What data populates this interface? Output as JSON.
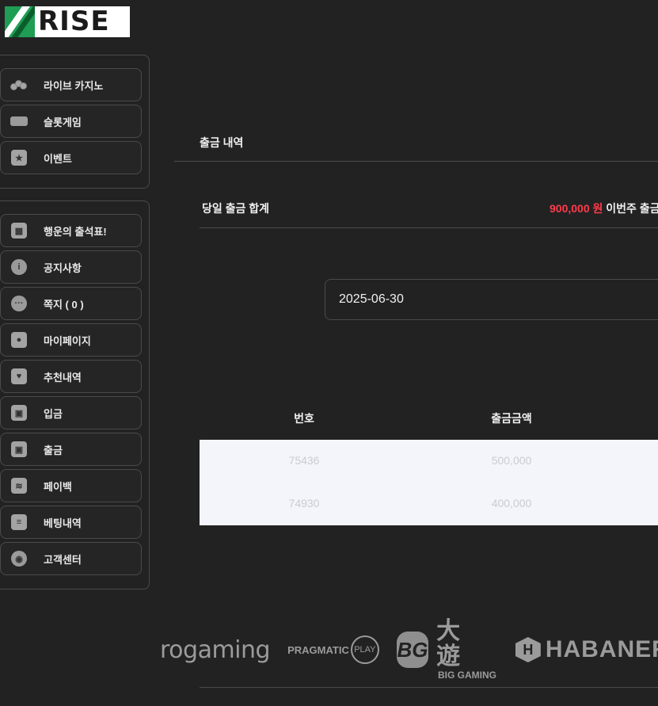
{
  "brand": {
    "name": "RISE"
  },
  "sidebar": {
    "group1": [
      {
        "label": "라이브 카지노",
        "icon": "casino-chips-icon"
      },
      {
        "label": "슬롯게임",
        "icon": "slot-machine-icon"
      },
      {
        "label": "이벤트",
        "icon": "event-star-icon"
      }
    ],
    "group2": [
      {
        "label": "행운의 출석표!",
        "icon": "calendar-icon"
      },
      {
        "label": "공지사항",
        "icon": "info-icon",
        "glyph": "i"
      },
      {
        "label": "쪽지 ( 0 )",
        "icon": "message-icon",
        "glyph": "···"
      },
      {
        "label": "마이페이지",
        "icon": "user-icon"
      },
      {
        "label": "추천내역",
        "icon": "heart-icon",
        "glyph": "♥"
      },
      {
        "label": "입금",
        "icon": "wallet-deposit-icon"
      },
      {
        "label": "출금",
        "icon": "wallet-withdraw-icon"
      },
      {
        "label": "페이백",
        "icon": "coins-icon"
      },
      {
        "label": "베팅내역",
        "icon": "bet-history-icon"
      },
      {
        "label": "고객센터",
        "icon": "support-icon"
      }
    ]
  },
  "main": {
    "title": "출금 내역",
    "summary": {
      "label": "당일 출금 합계",
      "amount": "900,000 원",
      "week_label": "이번주 출금 합계"
    },
    "date_value": "2025-06-30",
    "table": {
      "headers": [
        "번호",
        "출금금액"
      ],
      "rows": [
        [
          "75436",
          "500,000"
        ],
        [
          "74930",
          "400,000"
        ]
      ]
    },
    "providers": [
      {
        "name": "evolution-gaming",
        "text": "rogaming"
      },
      {
        "name": "pragmatic-play",
        "text": "PRAGMATIC",
        "badge": "PLAY"
      },
      {
        "name": "big-gaming",
        "badge": "BG",
        "cn": "大遊",
        "text": "BIG GAMING"
      },
      {
        "name": "habanero",
        "text": "HABANERO",
        "glyph": "H"
      }
    ]
  },
  "colors": {
    "accent_red": "#ff3b4a",
    "background": "#232223",
    "table_bg": "#f4f5fb"
  }
}
